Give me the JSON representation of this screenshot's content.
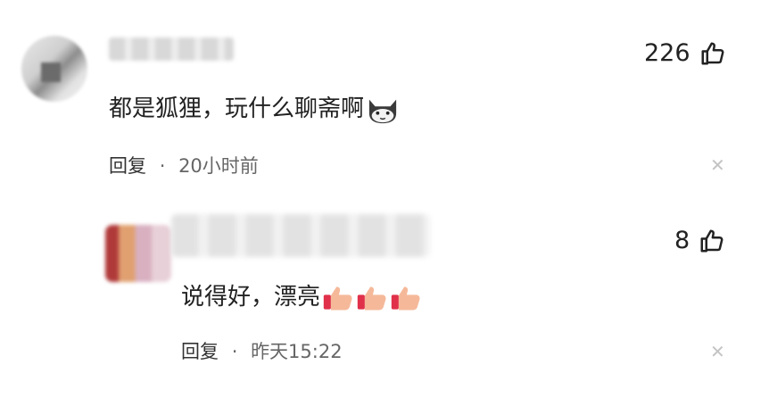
{
  "comment": {
    "like_count": "226",
    "text": "都是狐狸，玩什么聊斋啊",
    "reply_label": "回复",
    "separator": "·",
    "time": "20小时前"
  },
  "reply": {
    "like_count": "8",
    "text": "说得好，漂亮",
    "reply_label": "回复",
    "separator": "·",
    "time": "昨天15:22"
  },
  "icons": {
    "like": "thumbs-up-outline-icon",
    "close": "close-icon",
    "cat_emoji": "cat-face-emoji",
    "thumb_emoji": "thumbs-up-emoji"
  },
  "colors": {
    "text": "#222222",
    "meta": "#666666",
    "close": "#c4c4c4",
    "emoji_skin": "#f5b99a",
    "emoji_cuff": "#e0304a"
  }
}
